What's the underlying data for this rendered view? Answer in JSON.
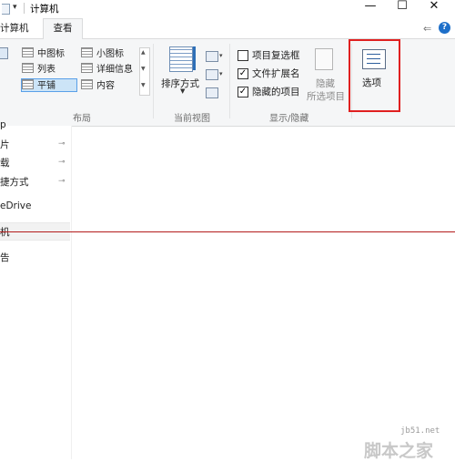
{
  "titlebar": {
    "title": "计算机",
    "minimize": "—",
    "maximize": "☐",
    "close": "✕",
    "qat_dropdown": "▾"
  },
  "tabs": {
    "computer": "计算机",
    "view": "查看"
  },
  "ribbon": {
    "layout": {
      "group_label": "布局",
      "items": [
        "中图标",
        "小图标",
        "列表",
        "详细信息",
        "平铺",
        "内容"
      ],
      "selected": "平铺"
    },
    "current_view": {
      "group_label": "当前视图",
      "sort_label": "排序方式"
    },
    "show_hide": {
      "group_label": "显示/隐藏",
      "checkboxes": [
        {
          "label": "项目复选框",
          "checked": false
        },
        {
          "label": "文件扩展名",
          "checked": true
        },
        {
          "label": "隐藏的项目",
          "checked": true
        }
      ],
      "hide_selected_line1": "隐藏",
      "hide_selected_line2": "所选项目",
      "options_label": "选项"
    }
  },
  "nav": {
    "items": [
      "p",
      "片",
      "载",
      "捷方式",
      "eDrive",
      "机",
      "告"
    ],
    "pins": [
      "📌",
      "📌",
      "📌"
    ]
  },
  "watermark": {
    "url": "jb51.net",
    "text": "脚本之家"
  },
  "icons": {
    "help": "?",
    "pin": "⇐",
    "check": "✓"
  },
  "colors": {
    "highlight_box": "#e02020",
    "selected_bg": "#cce4f7",
    "ribbon_bg": "#f5f6f7"
  }
}
